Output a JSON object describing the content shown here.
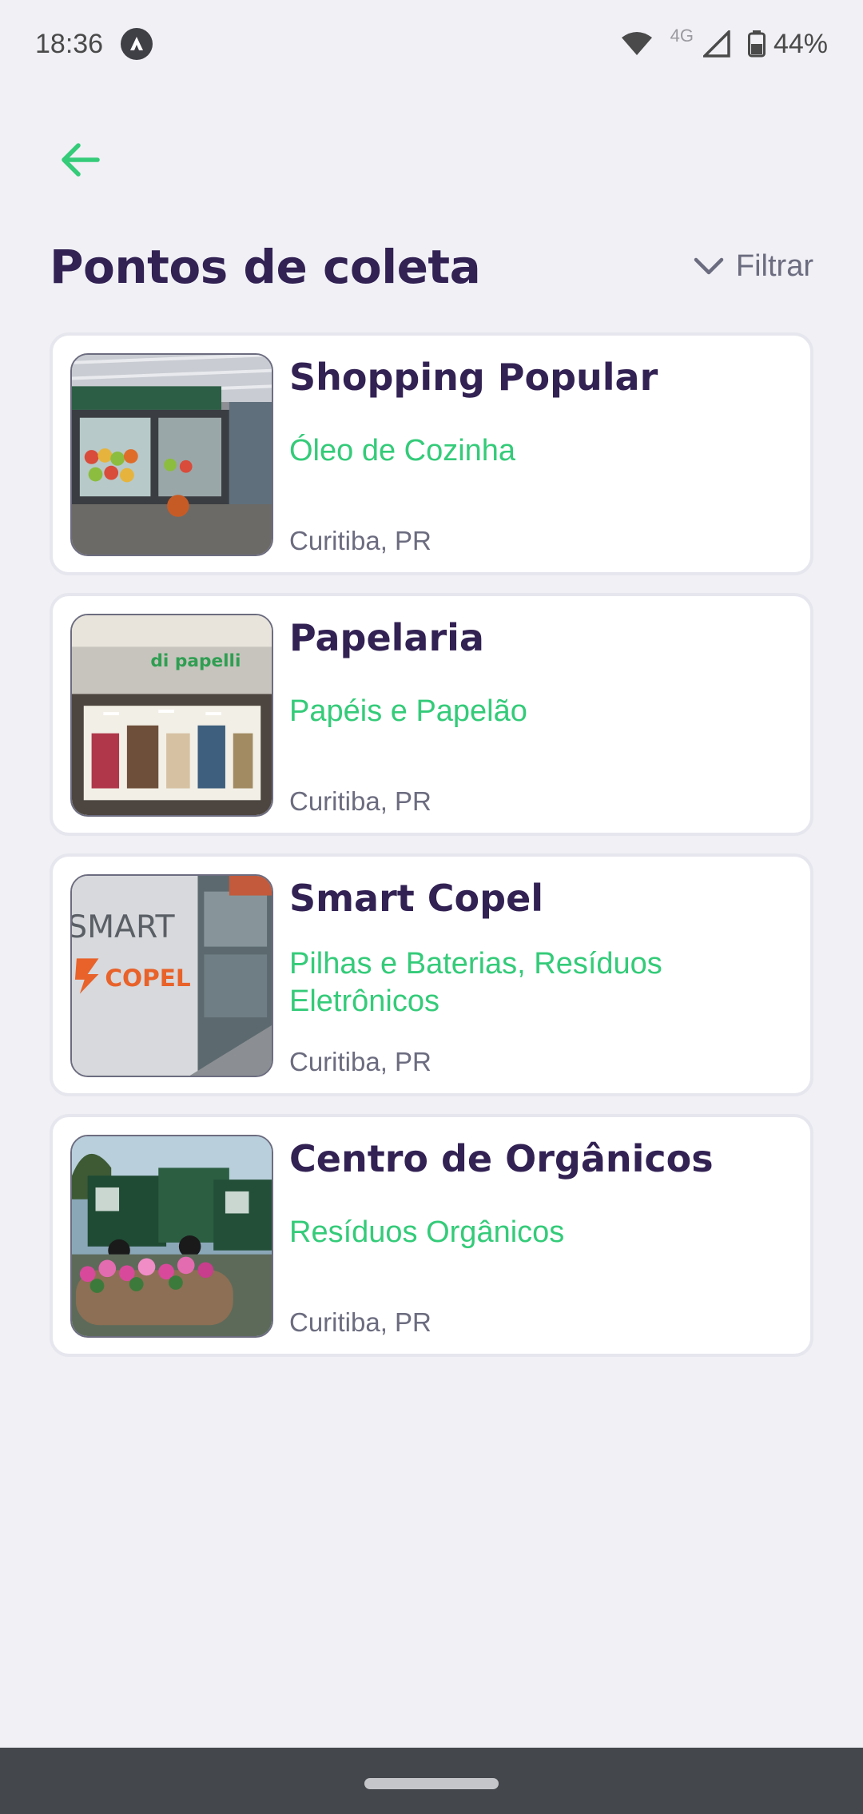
{
  "status_bar": {
    "time": "18:36",
    "network": "4G",
    "battery": "44%"
  },
  "header": {
    "title": "Pontos de coleta",
    "filter_label": "Filtrar"
  },
  "points": [
    {
      "name": "Shopping Popular",
      "items": "Óleo de Cozinha",
      "city": "Curitiba, PR"
    },
    {
      "name": "Papelaria",
      "items": "Papéis e Papelão",
      "city": "Curitiba, PR"
    },
    {
      "name": "Smart Copel",
      "items": "Pilhas e Baterias, Resíduos Eletrônicos",
      "city": "Curitiba, PR"
    },
    {
      "name": "Centro de Orgânicos",
      "items": "Resíduos Orgânicos",
      "city": "Curitiba, PR"
    }
  ],
  "image_text": {
    "papelaria_sign": "di papelli",
    "copel_sign_top": "SMART",
    "copel_sign_bottom": "COPEL"
  },
  "colors": {
    "background": "#f0f0f5",
    "title": "#322153",
    "accent_green": "#34cb79",
    "muted": "#6c6c80",
    "nav_bar": "#44474c"
  }
}
